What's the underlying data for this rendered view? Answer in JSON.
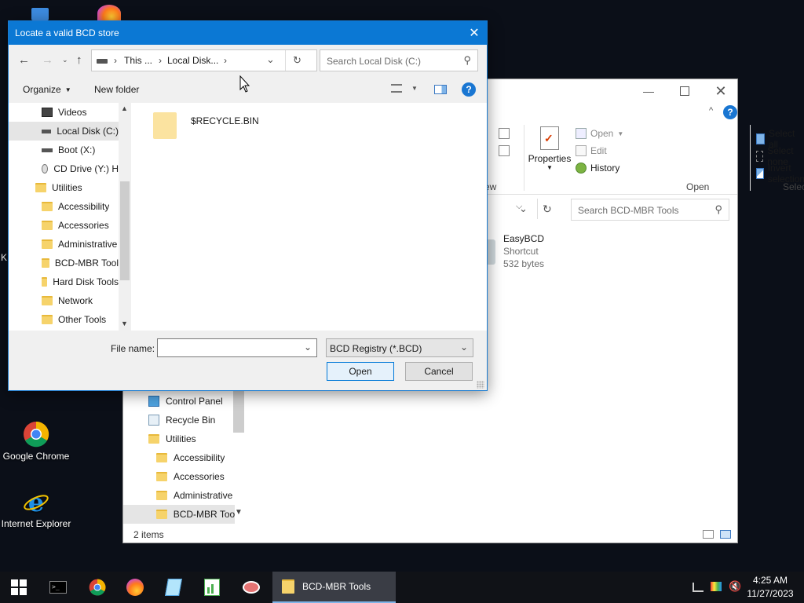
{
  "desktop": {
    "icons": [
      {
        "label": "Google Chrome"
      },
      {
        "label": "Internet Explorer"
      }
    ],
    "edge_letter": "K"
  },
  "explorer": {
    "ribbon": {
      "open_label": "Open",
      "edit_label": "Edit",
      "history_label": "History",
      "properties_label": "Properties",
      "select_all_label": "Select all",
      "select_none_label": "Select none",
      "invert_selection_label": "Invert selection",
      "group_new_fragment": "ew",
      "group_open": "Open",
      "group_select": "Select",
      "fragment_r": "r"
    },
    "search_placeholder": "Search BCD-MBR Tools",
    "file": {
      "name": "EasyBCD",
      "type": "Shortcut",
      "size": "532 bytes"
    },
    "nav_items": [
      "Control Panel",
      "Recycle Bin",
      "Utilities",
      "Accessibility",
      "Accessories",
      "Administrative",
      "BCD-MBR Tools"
    ],
    "status_items": "2 items"
  },
  "dialog": {
    "title": "Locate a valid BCD store",
    "breadcrumb": [
      "This ...",
      "Local Disk..."
    ],
    "search_placeholder": "Search Local Disk (C:)",
    "organize_label": "Organize",
    "new_folder_label": "New folder",
    "tree": [
      "Videos",
      "Local Disk (C:)",
      "Boot (X:)",
      "CD Drive (Y:) H",
      "Utilities",
      "Accessibility",
      "Accessories",
      "Administrative",
      "BCD-MBR Tool",
      "Hard Disk Tools",
      "Network",
      "Other Tools"
    ],
    "files": [
      {
        "name": "$RECYCLE.BIN"
      }
    ],
    "file_name_label": "File name:",
    "file_name_value": "",
    "file_type": "BCD Registry (*.BCD)",
    "open_label": "Open",
    "cancel_label": "Cancel"
  },
  "taskbar": {
    "active_app": "BCD-MBR Tools",
    "time": "4:25 AM",
    "date": "11/27/2023"
  },
  "colors": {
    "title_blue": "#0b78d4",
    "selection": "#e5e5e5",
    "folder": "#f6d36b"
  }
}
